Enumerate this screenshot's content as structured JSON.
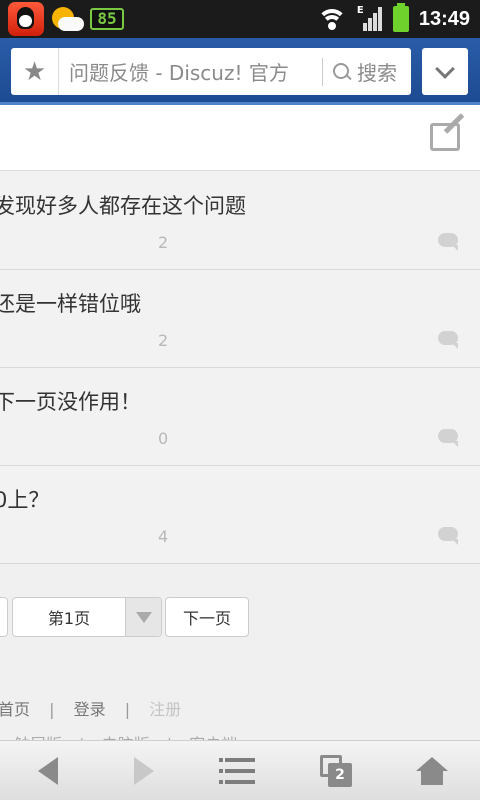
{
  "status_bar": {
    "notification_badge": "85",
    "time": "13:49"
  },
  "url_bar": {
    "title": "问题反馈 - Discuz! 官方",
    "search_label": "搜索"
  },
  "threads": [
    {
      "title": "发现好多人都存在这个问题",
      "replies": "2"
    },
    {
      "title": "还是一样错位哦",
      "replies": "2"
    },
    {
      "title": "下一页没作用！",
      "replies": "0"
    },
    {
      "title": "0上？",
      "replies": "4"
    }
  ],
  "pagination": {
    "current_page": "第1页",
    "next_label": "下一页"
  },
  "footer": {
    "links": [
      "首页",
      "登录",
      "注册"
    ],
    "separator": "|",
    "links2": [
      "触屏版",
      "|",
      "电脑版",
      "|",
      "客户端"
    ]
  },
  "toolbar": {
    "tab_count": "2"
  }
}
